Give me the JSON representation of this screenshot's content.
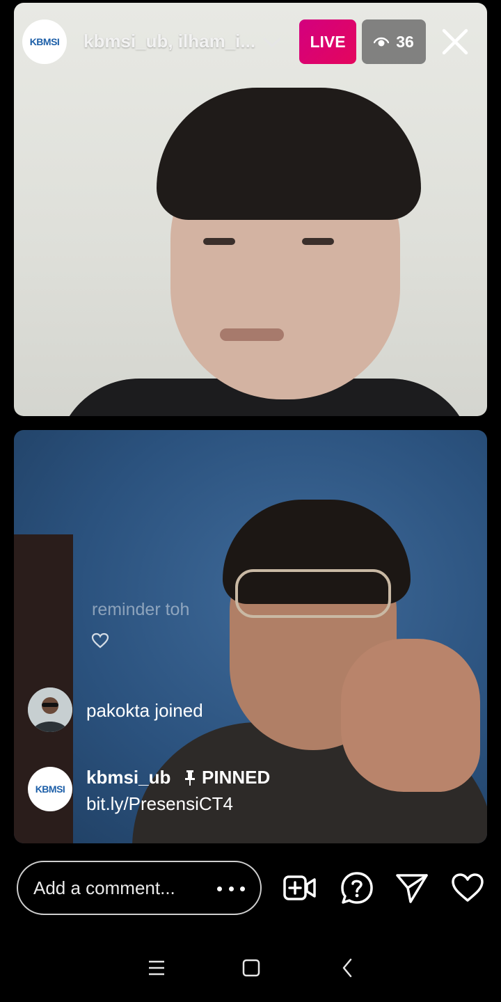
{
  "header": {
    "host_names": "kbmsi_ub, ilham_i...",
    "live_label": "LIVE",
    "viewer_count": "36"
  },
  "host_logo": {
    "text": "KBMSI"
  },
  "comments": {
    "faded_text": "reminder toh",
    "join_notice": "pakokta joined",
    "pinned": {
      "username": "kbmsi_ub",
      "label": "PINNED",
      "message": "bit.ly/PresensiCT4"
    }
  },
  "comment_input": {
    "placeholder": "Add a comment..."
  },
  "icons": {
    "chevron": "chevron-down-icon",
    "eye": "eye-icon",
    "close": "close-icon",
    "pin": "pin-icon",
    "add_video": "add-video-icon",
    "question": "question-icon",
    "share": "send-icon",
    "like": "heart-icon"
  },
  "colors": {
    "live_badge": "#d3007f",
    "viewer_badge": "#6e6e6e",
    "background": "#000000"
  }
}
